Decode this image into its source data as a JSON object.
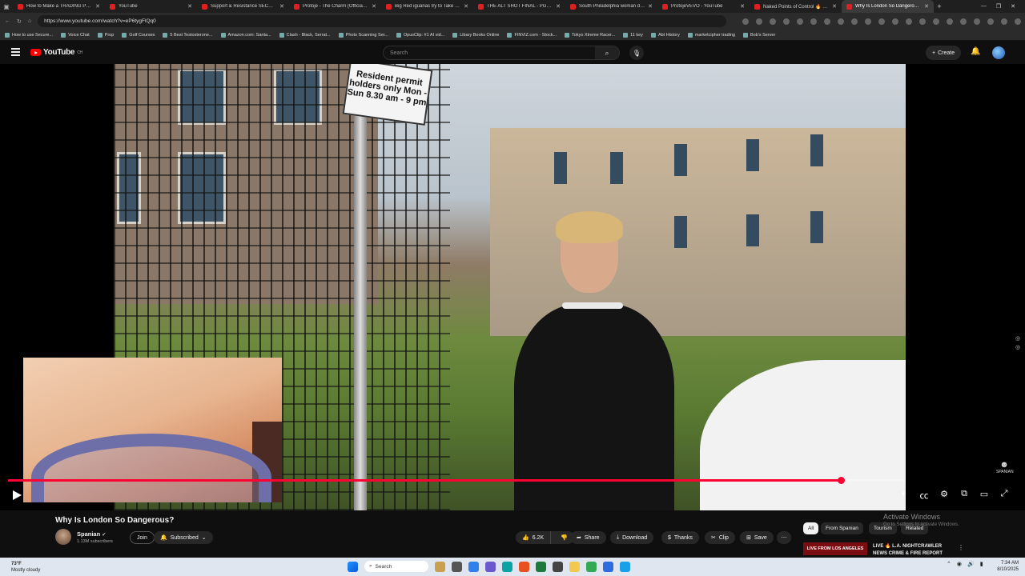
{
  "browser": {
    "tabs": [
      {
        "title": "How to Make a TRADING PLAN",
        "color": "#e02020"
      },
      {
        "title": "YouTube",
        "color": "#e02020"
      },
      {
        "title": "Support & Resistance SECRETS",
        "color": "#e02020"
      },
      {
        "title": "Protoje - The Charm (Official Vi",
        "color": "#e02020"
      },
      {
        "title": "Big Red iguanas try to Take Ov",
        "color": "#e02020"
      },
      {
        "title": "THE ALT SHOT FINAL - PGA TO",
        "color": "#e02020"
      },
      {
        "title": "South Philadelphia woman des",
        "color": "#e02020"
      },
      {
        "title": "ProtojeVEVO - YouTube",
        "color": "#e02020"
      },
      {
        "title": "Naked Points of Control 🔥 FRE",
        "color": "#e02020"
      },
      {
        "title": "Why Is London So Dangerous?",
        "color": "#e02020",
        "active": true
      }
    ],
    "url": "https://www.youtube.com/watch?v=eP6tygFlQq0",
    "bookmarks": [
      "How to use Secure...",
      "Voice Chat",
      "Prop",
      "Golf Courses",
      "5 Best Testosterone...",
      "Amazon.com: Santa...",
      "Clash - Black, Serrat...",
      "Photo Scanning Ser...",
      "OpusClip: #1 AI vid...",
      "Libary Books Online",
      "FINVIZ.com - Stock...",
      "Tokyo Xtreme Racer...",
      "11 key",
      "Abt History",
      "marketcipher trading",
      "Bob's Server"
    ]
  },
  "youtube": {
    "logo_text": "YouTube",
    "logo_region": "CH",
    "search_placeholder": "Search",
    "create_label": "Create"
  },
  "video": {
    "sign_text": "Resident permit holders only Mon - Sun 8.30 am - 9 pm",
    "progress_fraction": 0.929,
    "title": "Why Is London So Dangerous?",
    "channel": "Spanian",
    "subscribers": "1.13M subscribers",
    "join_label": "Join",
    "subscribed_label": "Subscribed",
    "likes": "6.2K",
    "share_label": "Share",
    "download_label": "Download",
    "thanks_label": "Thanks",
    "clip_label": "Clip",
    "save_label": "Save",
    "watermark": "SPANIAN"
  },
  "side": {
    "chips": [
      "All",
      "From Spanian",
      "Tourism",
      "Related"
    ],
    "activate_title": "Activate Windows",
    "activate_sub": "Go to Settings to activate Windows.",
    "upnext_badge": "LIVE FROM LOS ANGELES",
    "upnext_title": "LIVE 🔥 L.A. NIGHTCRAWLER NEWS CRIME & FIRE REPORT"
  },
  "taskbar": {
    "temp": "73°F",
    "weather": "Mostly cloudy",
    "search": "Search",
    "time": "7:34 AM",
    "date": "8/10/2025"
  }
}
